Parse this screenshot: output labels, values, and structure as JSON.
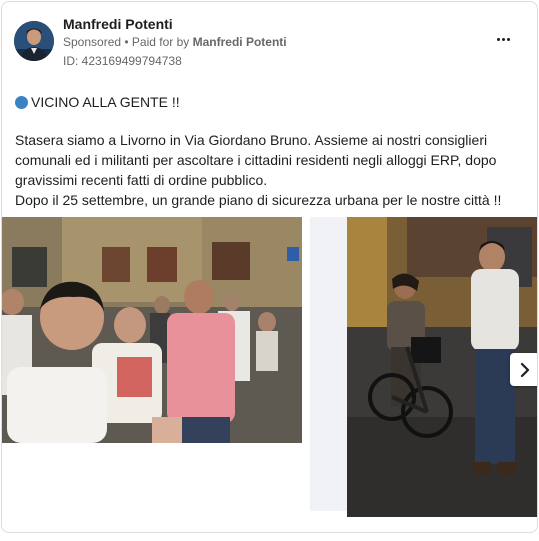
{
  "post": {
    "author": "Manfredi Potenti",
    "sponsored_label": "Sponsored",
    "separator": " • ",
    "paid_prefix": "Paid for by ",
    "paid_by": "Manfredi Potenti",
    "ad_id": "ID: 423169499794738",
    "headline": "VICINO ALLA GENTE !!",
    "body_lines": [
      "Stasera siamo a Livorno in Via Giordano Bruno. Assieme ai nostri consiglieri",
      "comunali ed i militanti per ascoltare i cittadini residenti negli alloggi ERP, dopo",
      "gravissimi recenti fatti di ordine pubblico.",
      "Dopo il 25 settembre, un grande piano di sicurezza urbana per le nostre città !!"
    ]
  },
  "icons": {
    "more": "more-options-icon",
    "next": "chevron-right-icon",
    "headline_dot": "blue-circle-icon"
  },
  "colors": {
    "text": "#1c1e21",
    "secondary": "#65676b",
    "border": "#dadde1",
    "accent_dot": "#3b82c4"
  }
}
